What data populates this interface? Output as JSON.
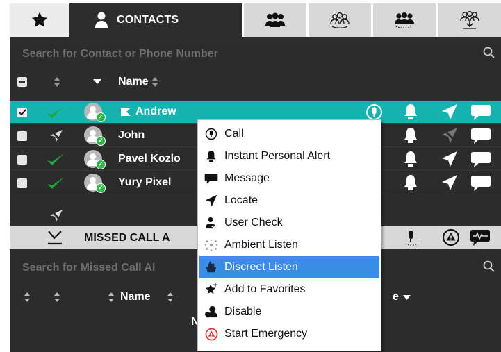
{
  "tabs": [
    {
      "icon": "star-icon"
    },
    {
      "icon": "person-icon",
      "label": "CONTACTS"
    },
    {
      "icon": "group-icon"
    },
    {
      "icon": "talkgroup-icon"
    },
    {
      "icon": "dynamic-group-icon"
    },
    {
      "icon": "talkgroup-download-icon"
    }
  ],
  "contacts": {
    "search_placeholder": "Search for Contact or Phone Number",
    "name_header": "Name",
    "rows": [
      {
        "name": "Andrew",
        "selected": true,
        "checked": true,
        "status": "online"
      },
      {
        "name": "John",
        "selected": false,
        "checked": false,
        "status": "offline"
      },
      {
        "name": "Pavel Kozlo",
        "selected": false,
        "checked": false,
        "status": "online"
      },
      {
        "name": "Yury Pixel",
        "selected": false,
        "checked": false,
        "status": "online"
      }
    ]
  },
  "missed": {
    "title": "MISSED CALL A",
    "search_placeholder": "Search for Missed Call Al",
    "name_header": "Name",
    "header_suffix": "e",
    "partial_text": "N"
  },
  "context_menu": {
    "items": [
      {
        "label": "Call",
        "icon": "mic-circle-icon"
      },
      {
        "label": "Instant Personal Alert",
        "icon": "bell-icon"
      },
      {
        "label": "Message",
        "icon": "speech-bubble-icon"
      },
      {
        "label": "Locate",
        "icon": "locate-arrow-icon"
      },
      {
        "label": "User Check",
        "icon": "user-check-icon"
      },
      {
        "label": "Ambient Listen",
        "icon": "ambient-listen-icon"
      },
      {
        "label": "Discreet Listen",
        "icon": "discreet-listen-icon",
        "highlighted": true
      },
      {
        "label": "Add to Favorites",
        "icon": "star-plus-icon"
      },
      {
        "label": "Disable",
        "icon": "user-disable-icon"
      },
      {
        "label": "Start Emergency",
        "icon": "emergency-icon"
      }
    ]
  },
  "colors": {
    "selected_row": "#17b3b0",
    "highlight": "#3a8ee6",
    "online": "#2eb84a",
    "emergency": "#e53935"
  }
}
